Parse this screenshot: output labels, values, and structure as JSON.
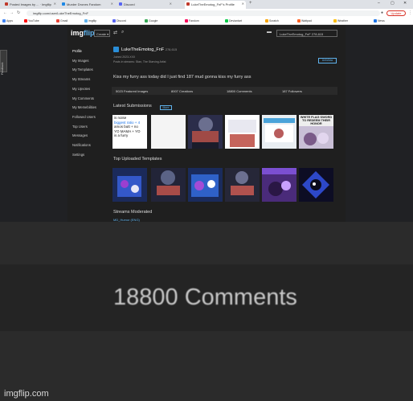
{
  "browser": {
    "tabs": [
      {
        "label": "Posted Images by ... · Imgflip",
        "color": "#c0392b"
      },
      {
        "label": "Murder Drones Fandom",
        "color": "#1e88e5"
      },
      {
        "label": "Discord",
        "color": "#5865f2"
      },
      {
        "label": "LukeTheEmotog_FnF's Profile",
        "color": "#c0392b",
        "active": true
      }
    ],
    "new_tab": "+",
    "window_controls": {
      "minimize": "–",
      "maximize": "▢",
      "close": "✕"
    },
    "address": "imgflip.com/user/LukeTheEmotog_FnF",
    "update_label": "Update",
    "bookmarks": [
      {
        "label": "Apps",
        "color": "#4285f4"
      },
      {
        "label": "YouTube",
        "color": "#ff0000"
      },
      {
        "label": "Gmail",
        "color": "#ea4335"
      },
      {
        "label": "imgflip",
        "color": "#5fb2ec"
      },
      {
        "label": "Discord",
        "color": "#5865f2"
      },
      {
        "label": "Google",
        "color": "#34a853"
      },
      {
        "label": "Fandom",
        "color": "#fa005a"
      },
      {
        "label": "Deviantart",
        "color": "#05cc47"
      },
      {
        "label": "Scratch",
        "color": "#f7a400"
      },
      {
        "label": "Wattpad",
        "color": "#ff6122"
      },
      {
        "label": "Weather",
        "color": "#fbbc05"
      },
      {
        "label": "News",
        "color": "#1a73e8"
      }
    ]
  },
  "feedback_label": "Feedback",
  "site": {
    "logo_img": "img",
    "logo_flip": "flip",
    "create_label": "Create ▾",
    "user_button": "LukeTheEmotog_FnF 278,615"
  },
  "sidebar": {
    "items": [
      "Profile",
      "My Images",
      "My Templates",
      "My Streams",
      "My Upvotes",
      "My Comments",
      "My Memebilities",
      "Followed Users",
      "Top Users",
      "Messages",
      "Notifications",
      "Settings"
    ]
  },
  "profile": {
    "username": "LukeTheEmotog_FnF",
    "points": "278,615",
    "joined": "Joined 2023-XXX",
    "streams": "Posts in streams: Stan, The Starving Artist",
    "follow_label": "Unfollow",
    "bio": "Kiss my furry ass today did I just find 187 mud gonna kiss my furry ass",
    "stats": [
      "5023 Featured Images",
      "8007 Creations",
      "18800 Comments",
      "187 Followers"
    ]
  },
  "sections": {
    "latest": "Latest Submissions",
    "more": "More",
    "templates": "Top Uploaded Templates",
    "streams": "Streams Moderated",
    "streams_link": "MD_Humor (ENG)"
  },
  "latest_text_thumb": [
    "is noise",
    "biggest ratio + 4",
    "amos butt + no",
    "YO MAMA + YO",
    "is a furry"
  ],
  "meme_caption": "WHITE FLAG SWORD TO REDEEM THEIR HONOR",
  "caption": "18800 Comments",
  "watermark": "imgflip.com"
}
